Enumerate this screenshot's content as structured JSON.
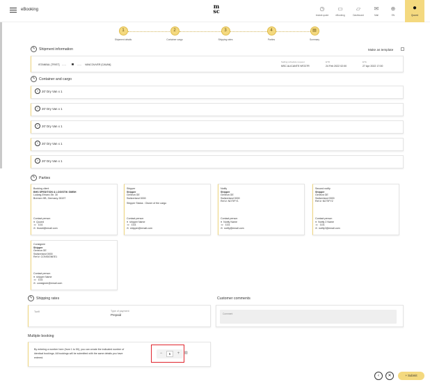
{
  "header": {
    "app_title": "eBooking",
    "logo": "msc",
    "nav": [
      {
        "label": "Instant quote",
        "icon": "stopwatch-icon",
        "glyph": "◷"
      },
      {
        "label": "eBooking",
        "icon": "cart-icon",
        "glyph": "▭"
      },
      {
        "label": "Dashboard",
        "icon": "truck-icon",
        "glyph": "▱"
      },
      {
        "label": "Mail",
        "icon": "mail-icon",
        "glyph": "✉"
      },
      {
        "label": "EN",
        "icon": "globe-icon",
        "glyph": "⊕"
      }
    ],
    "user": {
      "label": "Quoed",
      "icon": "user-icon",
      "glyph": "●"
    }
  },
  "steps": [
    {
      "num": "1",
      "label": "Shipment details"
    },
    {
      "num": "2",
      "label": "Container cargo"
    },
    {
      "num": "3",
      "label": "Shipping rates"
    },
    {
      "num": "4",
      "label": "Parties"
    },
    {
      "num": "",
      "label": "Summary"
    }
  ],
  "shipment": {
    "title": "Shipment information",
    "make_template": "Make as template",
    "origin": "ISTANBUL [TRIST]",
    "destination": "VANCOUVER [CAVAN]",
    "schedule_label": "Sailing schedule request",
    "schedule_value": "MSC ALICANTE NF227R",
    "etd_label": "ETD",
    "etd_value": "24 Feb 2022 02:00",
    "eta_label": "ETA",
    "eta_value": "27 Apr 2022 17:00"
  },
  "containers": {
    "title": "Container and cargo",
    "items": [
      "20' Dry Van x 1",
      "20' Dry Van x 1",
      "20' Dry Van x 1",
      "20' Dry Van x 1",
      "20' Dry Van x 1"
    ]
  },
  "parties": {
    "title": "Parties",
    "cards": [
      {
        "role": "Booking client",
        "name": "BHS SPEDITION & LOGISTIK GMBH",
        "lines": [
          "Ludwig-Erhard-Str. 30",
          "Bremen HB, Germany 28197",
          ""
        ],
        "contact_label": "Contact person",
        "person": "Quoed",
        "phone": "1111",
        "email": "thosbl@email.com"
      },
      {
        "role": "Shipper",
        "name": "Shipper",
        "lines": [
          "Geneva GE",
          "Switzerland 0000",
          "Shipper Status : Owner of the cargo"
        ],
        "contact_label": "Contact person",
        "person": "shipper Name",
        "phone": "1111",
        "email": "shipper@email.com"
      },
      {
        "role": "Notify",
        "name": "Shipper",
        "lines": [
          "Geneva GE",
          "Switzerland 0000",
          "Ref #: NOTIFY1"
        ],
        "contact_label": "Contact person",
        "person": "Notify Name",
        "phone": "1111",
        "email": "notify@email.com"
      },
      {
        "role": "Second notify",
        "name": "Shipper",
        "lines": [
          "Geneva GE",
          "Switzerland 0000",
          "Ref #: NOTIFY2"
        ],
        "contact_label": "Contact person",
        "person": "Notify 2 Name",
        "phone": "1111",
        "email": "notify2@email.com"
      },
      {
        "role": "Consignee",
        "name": "Shipper",
        "lines": [
          "Geneva GE",
          "Switzerland 0000",
          "Ref #: CONSIGNEE1"
        ],
        "contact_label": "Contact person",
        "person": "shipper Name",
        "phone": "1111",
        "email": "consignee@email.com"
      }
    ]
  },
  "rates": {
    "title": "Shipping rates",
    "tariff_label": "Tariff",
    "payment_label": "Type of payment",
    "payment_value": "Prepaid"
  },
  "comments": {
    "title": "Customer comments",
    "placeholder": "Comment"
  },
  "multiple": {
    "title": "Multiple booking",
    "text1": "By entering a number here (from 1 to 50), you can create the indicated number of",
    "text2": "identical bookings. All bookings will be submitted with the same details you have",
    "text3": "entered.",
    "value": "5"
  },
  "footer": {
    "submit_label": "+ Submit"
  },
  "colors": {
    "accent": "#f4d97f",
    "highlight": "#e0232b"
  }
}
